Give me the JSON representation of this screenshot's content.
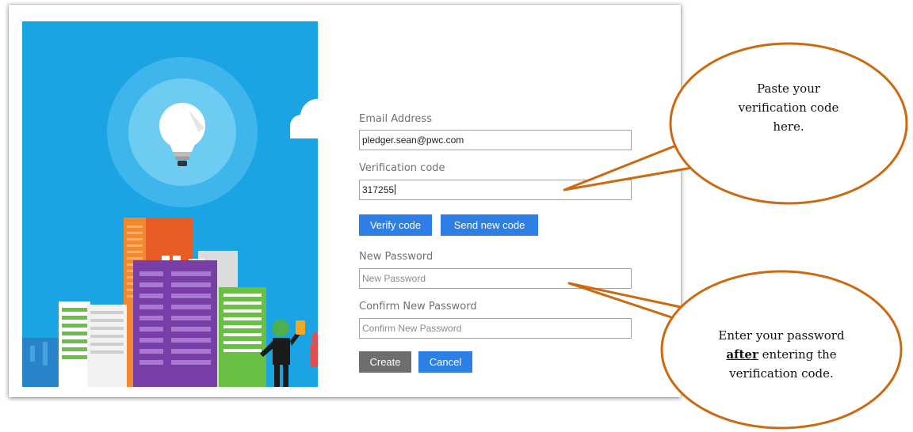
{
  "form": {
    "email_label": "Email Address",
    "email_value": "pledger.sean@pwc.com",
    "code_label": "Verification code",
    "code_value": "317255",
    "verify_button": "Verify code",
    "send_new_button": "Send new code",
    "new_password_label": "New Password",
    "new_password_placeholder": "New Password",
    "confirm_password_label": "Confirm New Password",
    "confirm_password_placeholder": "Confirm New Password",
    "create_button": "Create",
    "cancel_button": "Cancel"
  },
  "callouts": {
    "code": {
      "line1": "Paste your",
      "line2": "verification code",
      "line3": "here."
    },
    "password": {
      "line1": "Enter your password",
      "bold": "after",
      "line2_rest": " entering the",
      "line3": "verification code."
    }
  },
  "colors": {
    "sky": "#1aa4e4",
    "button_blue": "#2d7fe6",
    "button_gray": "#6e6e6e",
    "callout_border": "#cc6a12"
  },
  "icons": [
    "lightbulb-icon",
    "cloud-icon",
    "city-skyline",
    "person-figure"
  ]
}
